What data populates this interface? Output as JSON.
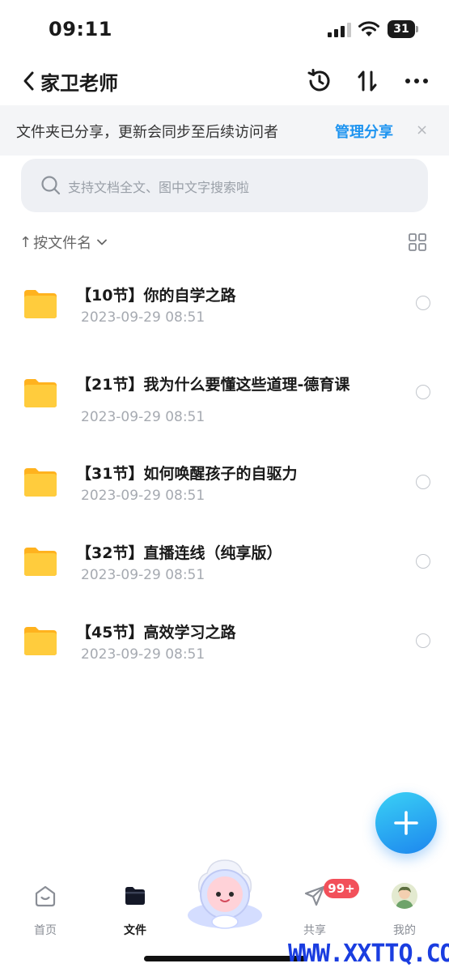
{
  "status_bar": {
    "time": "09:11",
    "battery": "31"
  },
  "nav": {
    "back_label": "家卫老师",
    "icons": [
      "history-icon",
      "sort-arrows-icon",
      "more-icon"
    ]
  },
  "banner": {
    "text": "文件夹已分享，更新会同步至后续访问者",
    "link": "管理分享",
    "close": "×"
  },
  "search": {
    "placeholder": "支持文档全文、图中文字搜索啦"
  },
  "sort": {
    "arrow": "↑",
    "label": "按文件名"
  },
  "files": [
    {
      "name": "【10节】你的自学之路",
      "date": "2023-09-29 08:51"
    },
    {
      "name": "【21节】我为什么要懂这些道理-德育课",
      "date": "2023-09-29 08:51"
    },
    {
      "name": "【31节】如何唤醒孩子的自驱力",
      "date": "2023-09-29 08:51"
    },
    {
      "name": "【32节】直播连线（纯享版）",
      "date": "2023-09-29 08:51"
    },
    {
      "name": "【45节】高效学习之路",
      "date": "2023-09-29 08:51"
    }
  ],
  "tabs": [
    {
      "label": "首页",
      "icon": "home-icon"
    },
    {
      "label": "文件",
      "icon": "folder-icon"
    },
    {
      "label": "共享",
      "icon": "send-icon"
    },
    {
      "label": "我的",
      "icon": "avatar"
    }
  ],
  "badge": "99+",
  "watermark": "WWW.XXTTQ.COM",
  "colors": {
    "accent": "#1e94f0",
    "folder": "#ffc83a",
    "badge": "#f2505a",
    "fab": "#1d86ee"
  }
}
